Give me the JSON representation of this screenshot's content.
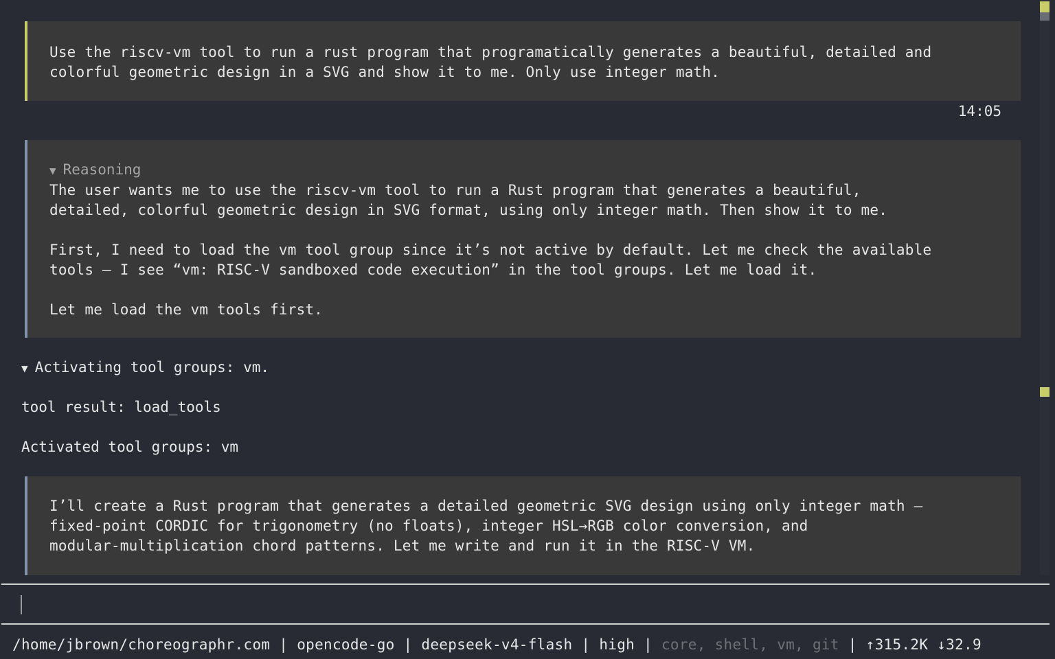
{
  "messages": {
    "user_prompt": "Use the riscv-vm tool to run a rust program that programatically generates a beautiful, detailed and\ncolorful geometric design in a SVG and show it to me. Only use integer math.",
    "timestamp": "14:05",
    "reasoning_label": "Reasoning",
    "reasoning_text": "The user wants me to use the riscv-vm tool to run a Rust program that generates a beautiful,\ndetailed, colorful geometric design in SVG format, using only integer math. Then show it to me.\n\nFirst, I need to load the vm tool group since it’s not active by default. Let me check the available\ntools – I see “vm: RISC-V sandboxed code execution” in the tool groups. Let me load it.\n\nLet me load the vm tools first.",
    "tool_activation": "Activating tool groups: vm.",
    "tool_result": "tool result: load_tools",
    "tool_output": "Activated tool groups: vm",
    "assistant_reply": "I’ll create a Rust program that generates a detailed geometric SVG design using only integer math —\nfixed-point CORDIC for trigonometry (no floats), integer HSL→RGB color conversion, and\nmodular-multiplication chord patterns. Let me write and run it in the RISC-V VM."
  },
  "icons": {
    "expanded": "▼"
  },
  "status_bar": {
    "cwd": "/home/jbrown/choreographr.com",
    "sep": " | ",
    "provider": "opencode-go",
    "model": "deepseek-v4-flash",
    "effort": "high",
    "tool_groups": "core, shell, vm, git",
    "tokens": "↑315.2K ↓32.9"
  },
  "colors": {
    "background": "#282b34",
    "panel": "#393939",
    "user_accent": "#c9cc6a",
    "assistant_accent": "#7f93b0",
    "dim_text": "#6f7178"
  }
}
